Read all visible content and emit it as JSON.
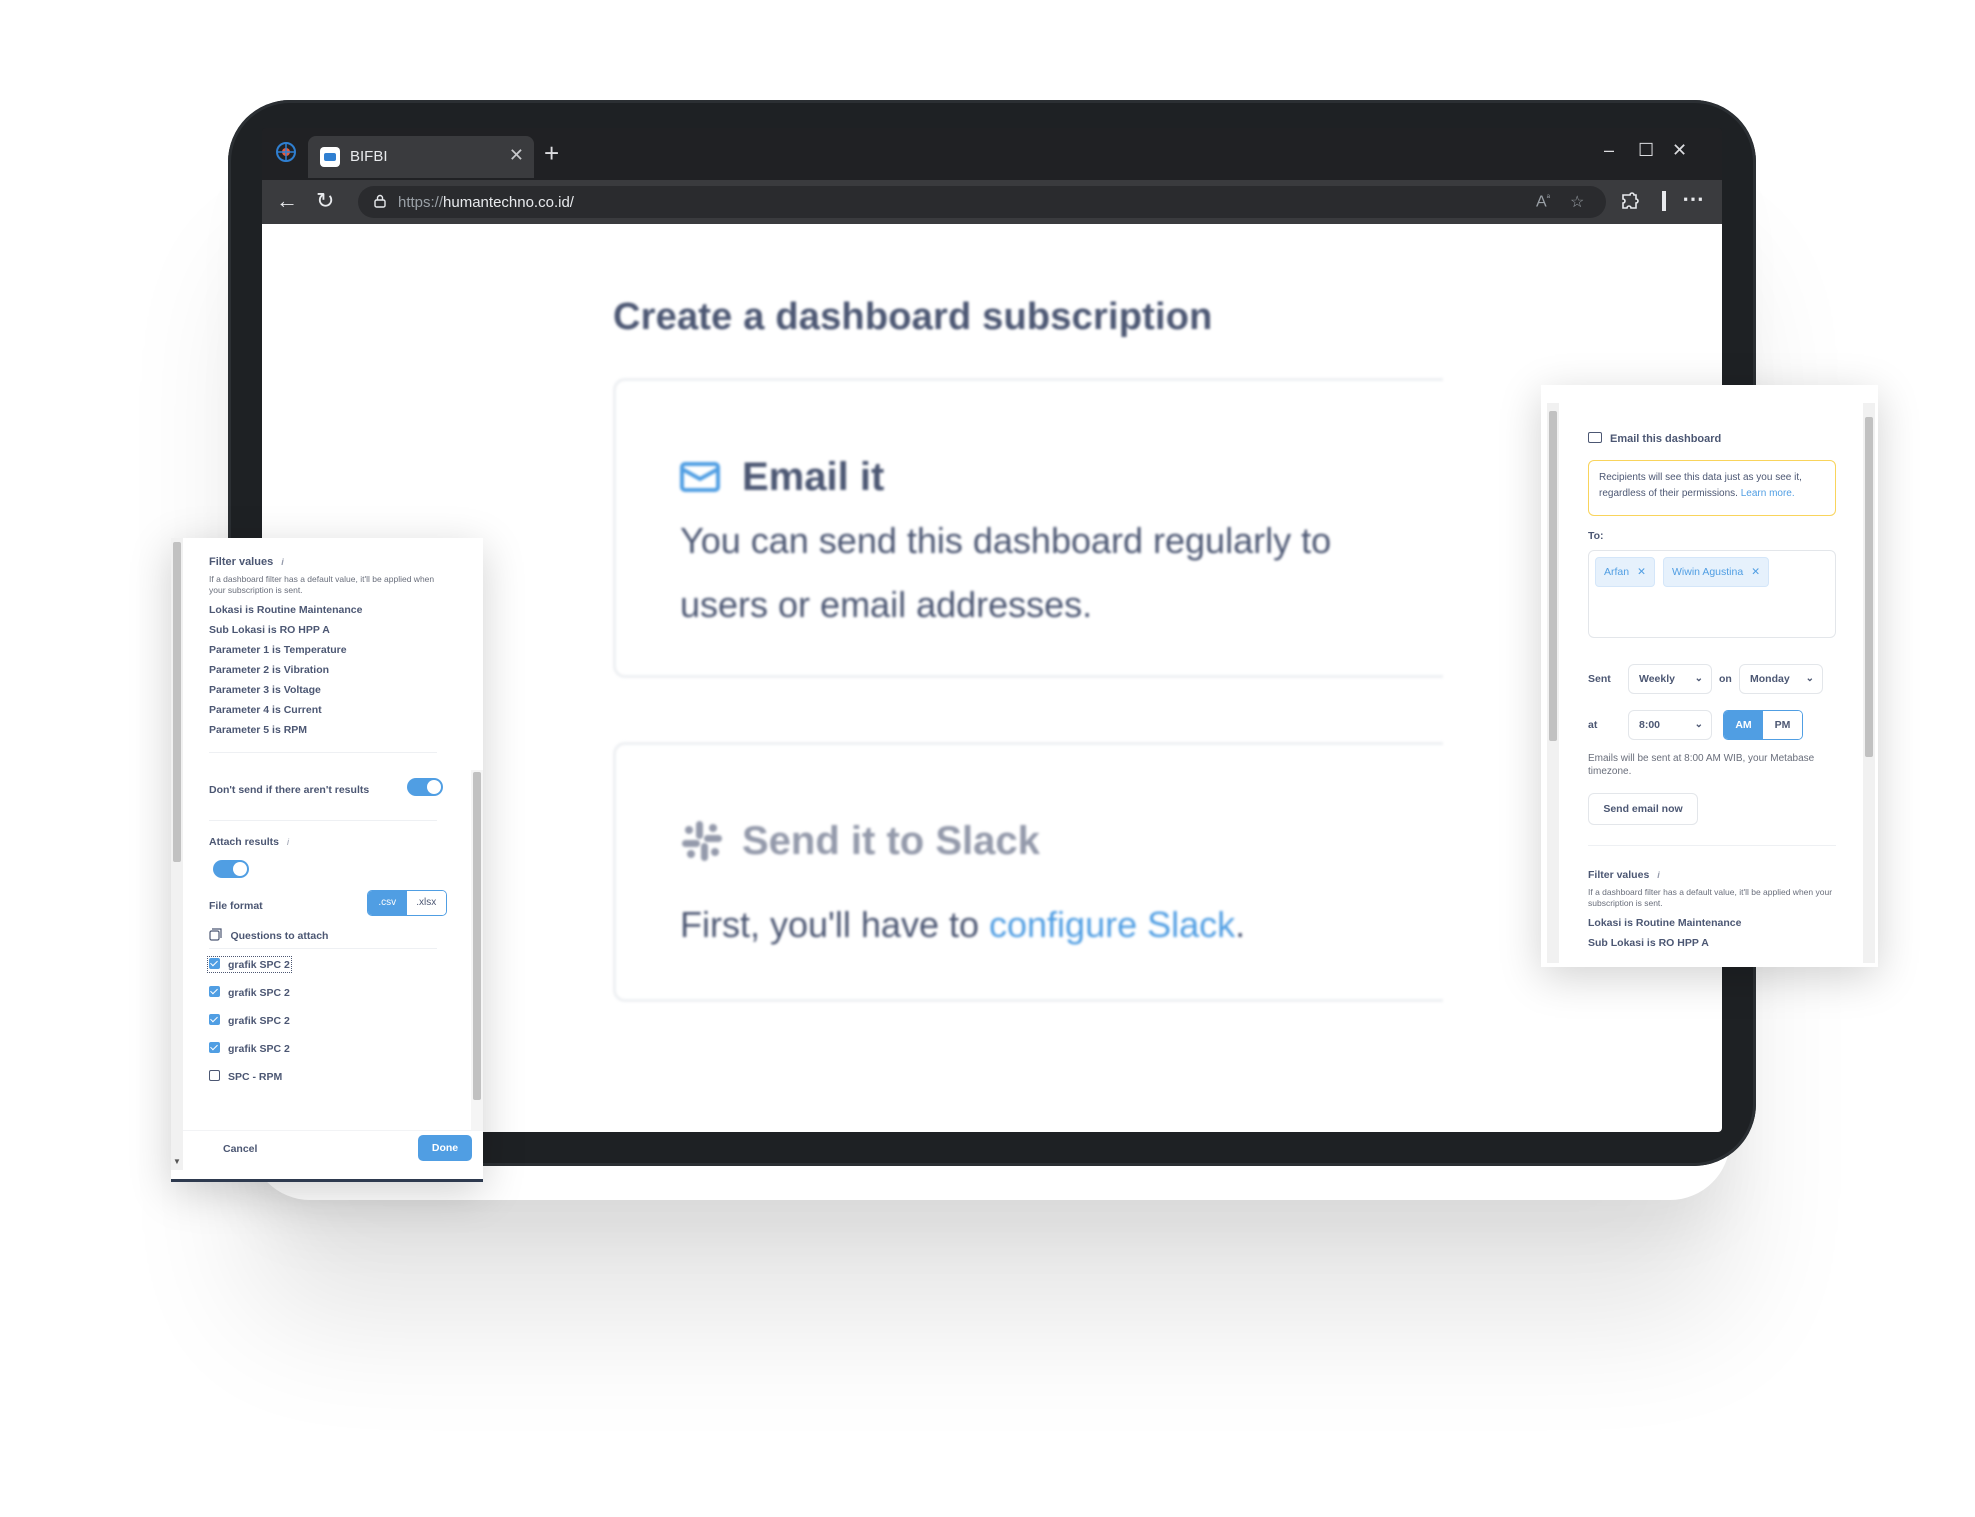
{
  "browser": {
    "tab_title": "BIFBI",
    "tab_close": "✕",
    "new_tab": "+",
    "url_scheme": "https://",
    "url_host": "humantechno.co.id/",
    "window_controls": {
      "minimize": "–",
      "maximize": "☐",
      "close": "✕"
    },
    "nav": {
      "back": "←",
      "reload": "↻"
    }
  },
  "page": {
    "heading": "Create a dashboard subscription",
    "email_card": {
      "title": "Email it",
      "body": "You can send this dashboard regularly to users or email addresses."
    },
    "slack_card": {
      "title": "Send it to Slack",
      "body_prefix": "First, you'll have to ",
      "link": "configure Slack",
      "body_suffix": "."
    }
  },
  "left_panel": {
    "filter_values_label": "Filter values",
    "info": "i",
    "filter_help": "If a dashboard filter has a default value, it'll be applied when your subscription is sent.",
    "filters": [
      "Lokasi is Routine Maintenance",
      "Sub Lokasi is RO HPP A",
      "Parameter 1 is Temperature",
      "Parameter 2 is Vibration",
      "Parameter 3 is Voltage",
      "Parameter 4 is Current",
      "Parameter 5 is RPM"
    ],
    "dont_send_label": "Don't send if there aren't results",
    "dont_send_on": true,
    "attach_results_label": "Attach results",
    "attach_results_on": true,
    "file_format_label": "File format",
    "formats": [
      ".csv",
      ".xlsx"
    ],
    "selected_format": ".csv",
    "questions_label": "Questions to attach",
    "questions": [
      {
        "label": "grafik SPC 2",
        "checked": true
      },
      {
        "label": "grafik SPC 2",
        "checked": true
      },
      {
        "label": "grafik SPC 2",
        "checked": true
      },
      {
        "label": "grafik SPC 2",
        "checked": true
      },
      {
        "label": "SPC - RPM",
        "checked": false
      }
    ],
    "cancel": "Cancel",
    "done": "Done"
  },
  "right_panel": {
    "title": "Email this dashboard",
    "warning": "Recipients will see this data just as you see it, regardless of their permissions.",
    "warning_link": "Learn more.",
    "to_label": "To:",
    "recipients": [
      "Arfan",
      "Wiwin Agustina"
    ],
    "chip_remove": "✕",
    "sent_label": "Sent",
    "frequency": "Weekly",
    "on_label": "on",
    "day": "Monday",
    "at_label": "at",
    "time": "8:00",
    "am": "AM",
    "pm": "PM",
    "selected_period": "AM",
    "timezone_note": "Emails will be sent at 8:00 AM WIB, your Metabase timezone.",
    "send_now": "Send email now",
    "filter_values_label": "Filter values",
    "info": "i",
    "filter_help": "If a dashboard filter has a default value, it'll be applied when your subscription is sent.",
    "filters": [
      "Lokasi is Routine Maintenance",
      "Sub Lokasi is RO HPP A"
    ]
  },
  "colors": {
    "brand": "#509ee3",
    "text": "#4c5773",
    "warning_border": "#f9d45c",
    "browser_chrome": "#202124"
  },
  "icons": [
    "app-logo-icon",
    "favicon-icon",
    "close-icon",
    "back-icon",
    "reload-icon",
    "lock-icon",
    "read-aloud-icon",
    "star-icon",
    "extensions-icon",
    "more-icon",
    "mail-icon",
    "slack-icon",
    "info-icon",
    "question-stack-icon",
    "chevron-down-icon"
  ]
}
